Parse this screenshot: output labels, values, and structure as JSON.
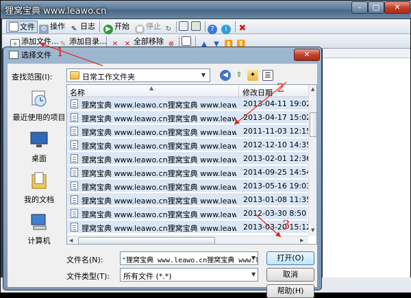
{
  "app": {
    "title": "狸窝宝典 www.leawo.cn",
    "window_buttons": {
      "minimize": "–",
      "maximize": "□",
      "close": "✕"
    },
    "toolbar1": [
      {
        "label": "文件",
        "icon": "file-icon"
      },
      {
        "label": "操作",
        "icon": "settings-icon"
      },
      {
        "label": "日志",
        "icon": "log-icon"
      },
      {
        "label": "开始",
        "icon": "play-icon"
      },
      {
        "label": "停止",
        "icon": "stop-icon"
      }
    ],
    "toolbar2": [
      {
        "label": "添加文件...",
        "icon": "add-file-icon"
      },
      {
        "label": "添加目录...",
        "icon": "add-folder-icon"
      },
      {
        "label": "全部移除",
        "icon": "remove-all-icon"
      }
    ]
  },
  "dialog": {
    "title": "选择文件",
    "close_label": "✕",
    "lookin_label": "查找范围(I):",
    "lookin_value": "日常工作文件夹",
    "places": [
      {
        "label": "最近使用的项目",
        "icon": "recent-items-icon"
      },
      {
        "label": "桌面",
        "icon": "desktop-icon"
      },
      {
        "label": "我的文档",
        "icon": "documents-icon"
      },
      {
        "label": "计算机",
        "icon": "computer-icon"
      }
    ],
    "columns": {
      "name": "名称",
      "date": "修改日期"
    },
    "files": [
      {
        "name": "狸窝宝典 www.leawo.cn狸窝宝典 www.leawo.cn...",
        "date": "2013-04-11 19:02"
      },
      {
        "name": "狸窝宝典 www.leawo.cn狸窝宝典 www.leawo.cn...",
        "date": "2013-04-17 15:02"
      },
      {
        "name": "狸窝宝典 www.leawo.cn狸窝宝典 www.leawo.cn...",
        "date": "2011-11-03 12:15"
      },
      {
        "name": "狸窝宝典 www.leawo.cn狸窝宝典 www.leawo.cn...",
        "date": "2012-12-10 14:35"
      },
      {
        "name": "狸窝宝典 www.leawo.cn狸窝宝典 www.leawo.cn...",
        "date": "2013-02-01 12:36"
      },
      {
        "name": "狸窝宝典 www.leawo.cn狸窝宝典 www.leawo.cn...",
        "date": "2014-09-25 14:54"
      },
      {
        "name": "狸窝宝典 www.leawo.cn狸窝宝典 www.leawo.cn...",
        "date": "2013-05-16 19:03"
      },
      {
        "name": "狸窝宝典 www.leawo.cn狸窝宝典 www.leawo.cn...",
        "date": "2013-01-08 11:35"
      },
      {
        "name": "狸窝宝典 www.leawo.cn狸窝宝典 www.leawo.cn...",
        "date": "2012-03-30 8:50"
      },
      {
        "name": "狸窝宝典 www.leawo.cn狸窝宝典 www.leawo.cn...",
        "date": "2013-03-20 15:12"
      }
    ],
    "filename_label": "文件名(N):",
    "filename_value": "\"狸窝宝典 www.leawo.cn狸窝宝典 www.le",
    "filetype_label": "文件类型(T):",
    "filetype_value": "所有文件 (*.*)",
    "open_label": "打开(O)",
    "cancel_label": "取消",
    "help_label": "帮助(H)"
  },
  "annotations": {
    "step1": "1",
    "step2": "2",
    "step3": "3",
    "color": "#e0261a"
  }
}
